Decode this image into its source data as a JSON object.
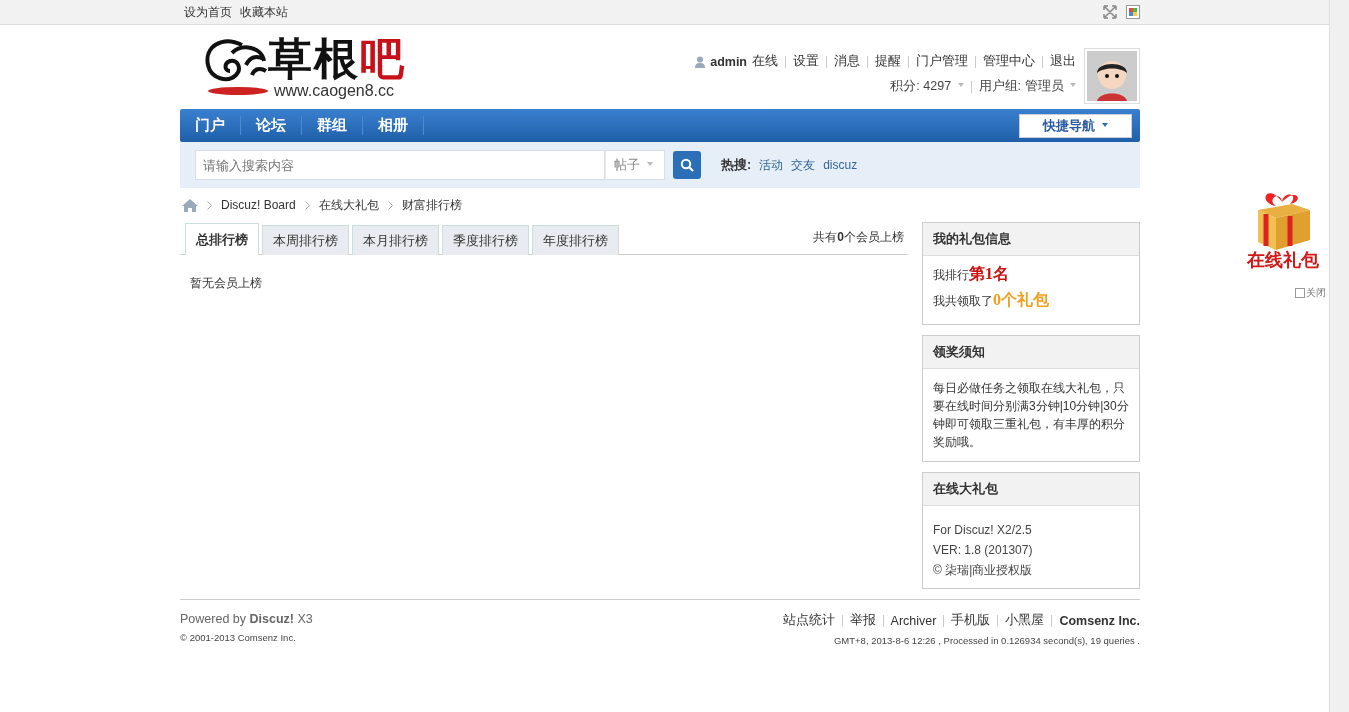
{
  "topbar": {
    "links": [
      "设为首页",
      "收藏本站"
    ]
  },
  "logo": {
    "name": "草根",
    "accent": "吧",
    "url": "www.caogen8.cc"
  },
  "user": {
    "name": "admin",
    "status": "在线",
    "links": [
      "设置",
      "消息",
      "提醒",
      "门户管理",
      "管理中心",
      "退出"
    ],
    "credits": "积分: 4297",
    "group": "用户组: 管理员"
  },
  "nav": {
    "items": [
      "门户",
      "论坛",
      "群组",
      "相册"
    ],
    "quick_nav": "快捷导航"
  },
  "search": {
    "placeholder": "请输入搜索内容",
    "type": "帖子",
    "hot_label": "热搜:",
    "hot": [
      "活动",
      "交友",
      "discuz"
    ]
  },
  "breadcrumb": [
    "Discuz! Board",
    "在线大礼包",
    "财富排行榜"
  ],
  "tabs": [
    {
      "label": "总排行榜",
      "selected": true
    },
    {
      "label": "本周排行榜",
      "selected": false
    },
    {
      "label": "本月排行榜",
      "selected": false
    },
    {
      "label": "季度排行榜",
      "selected": false
    },
    {
      "label": "年度排行榜",
      "selected": false
    }
  ],
  "count": "共有**0**个会员上榜",
  "empty": "暂无会员上榜",
  "sidebar": [
    {
      "kind": "stats",
      "title": "我的礼包信息",
      "items": [
        {
          "label": "我排行",
          "value": "第1名",
          "color": "#cc1111"
        },
        {
          "label": "我共领取了",
          "value": "0个礼包",
          "color": "#f0a020"
        }
      ]
    },
    {
      "kind": "text",
      "title": "领奖须知",
      "text": "每日必做任务之领取在线大礼包，只要在线时间分别满3分钟|10分钟|30分钟即可领取三重礼包，有丰厚的积分奖励哦。"
    },
    {
      "kind": "lines",
      "title": "在线大礼包",
      "lines": [
        "For Discuz! X2/2.5",
        "VER: 1.8 (201307)",
        "© 柒瑞|商业授权版"
      ]
    }
  ],
  "gift_widget": {
    "label": "在线礼包",
    "close": "关闭"
  },
  "footer": {
    "powered": "Powered by **Discuz!** X3",
    "copyright": "© 2001-2013 Comsenz Inc.",
    "links": [
      "站点统计",
      "举报",
      "Archiver",
      "手机版",
      "小黑屋"
    ],
    "company": "Comsenz Inc.",
    "stats": "GMT+8, 2013-8-6 12:26 , Processed in 0.126934 second(s), 19 queries ."
  }
}
